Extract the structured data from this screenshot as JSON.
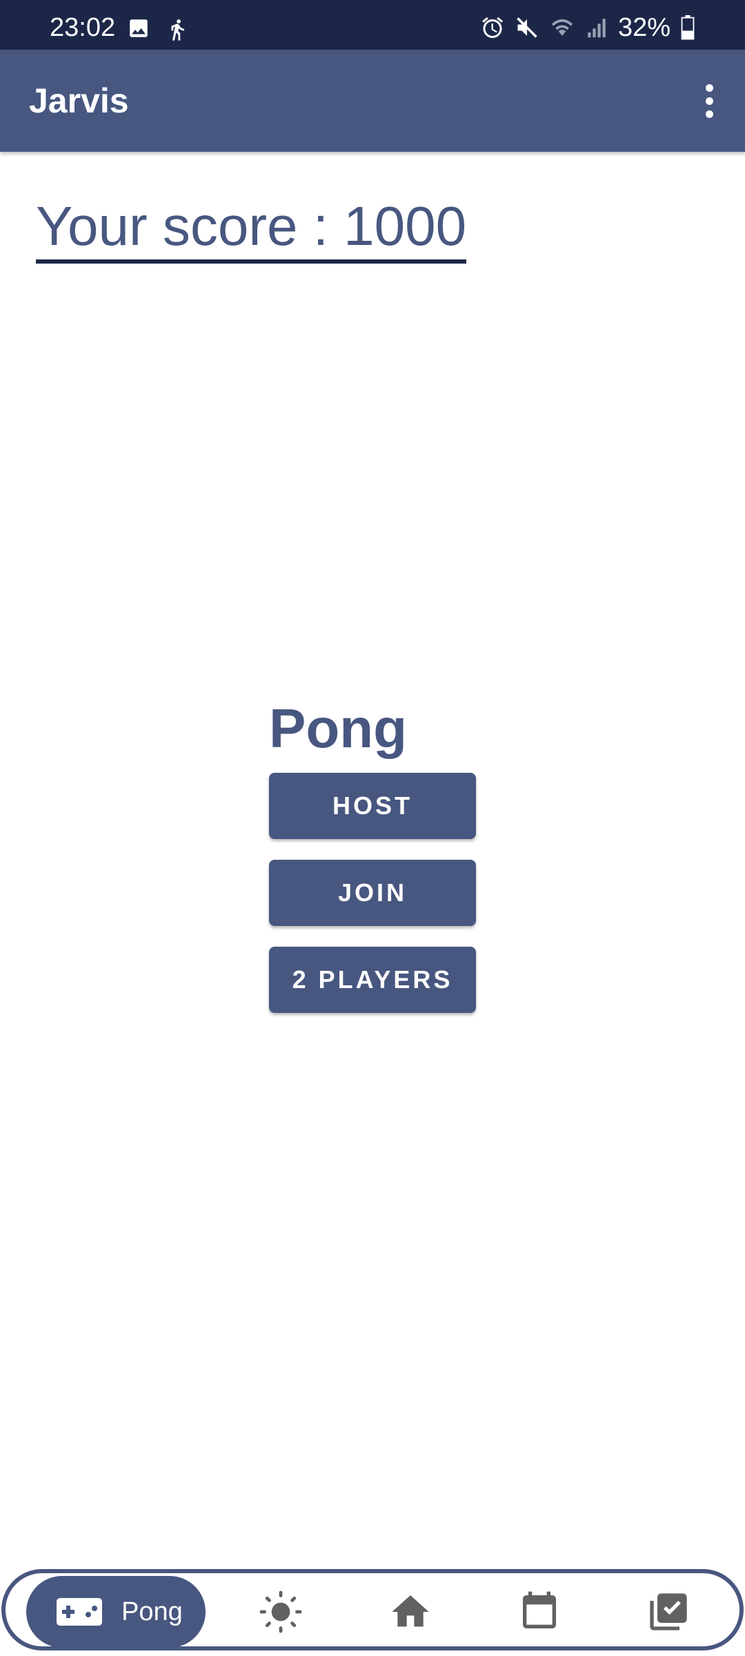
{
  "status_bar": {
    "time": "23:02",
    "battery": "32%",
    "left_icons": [
      "image-icon",
      "walking-icon"
    ],
    "right_icons": [
      "alarm-icon",
      "mute-icon",
      "wifi-icon",
      "signal-icon",
      "battery-icon"
    ]
  },
  "app_bar": {
    "title": "Jarvis",
    "menu_icon": "more-vert-icon"
  },
  "score": {
    "text": "Your score : 1000"
  },
  "game": {
    "title": "Pong",
    "buttons": {
      "host": "HOST",
      "join": "JOIN",
      "two_players": "2 PLAYERS"
    }
  },
  "bottom_nav": {
    "active": {
      "label": "Pong",
      "icon": "gamepad-icon"
    },
    "items": [
      {
        "icon": "sun-icon"
      },
      {
        "icon": "home-icon"
      },
      {
        "icon": "calendar-icon"
      },
      {
        "icon": "task-list-icon"
      }
    ]
  },
  "colors": {
    "primary": "#485780",
    "status_bar": "#1c2748",
    "background": "#ffffff",
    "inactive_icon": "#616161"
  }
}
